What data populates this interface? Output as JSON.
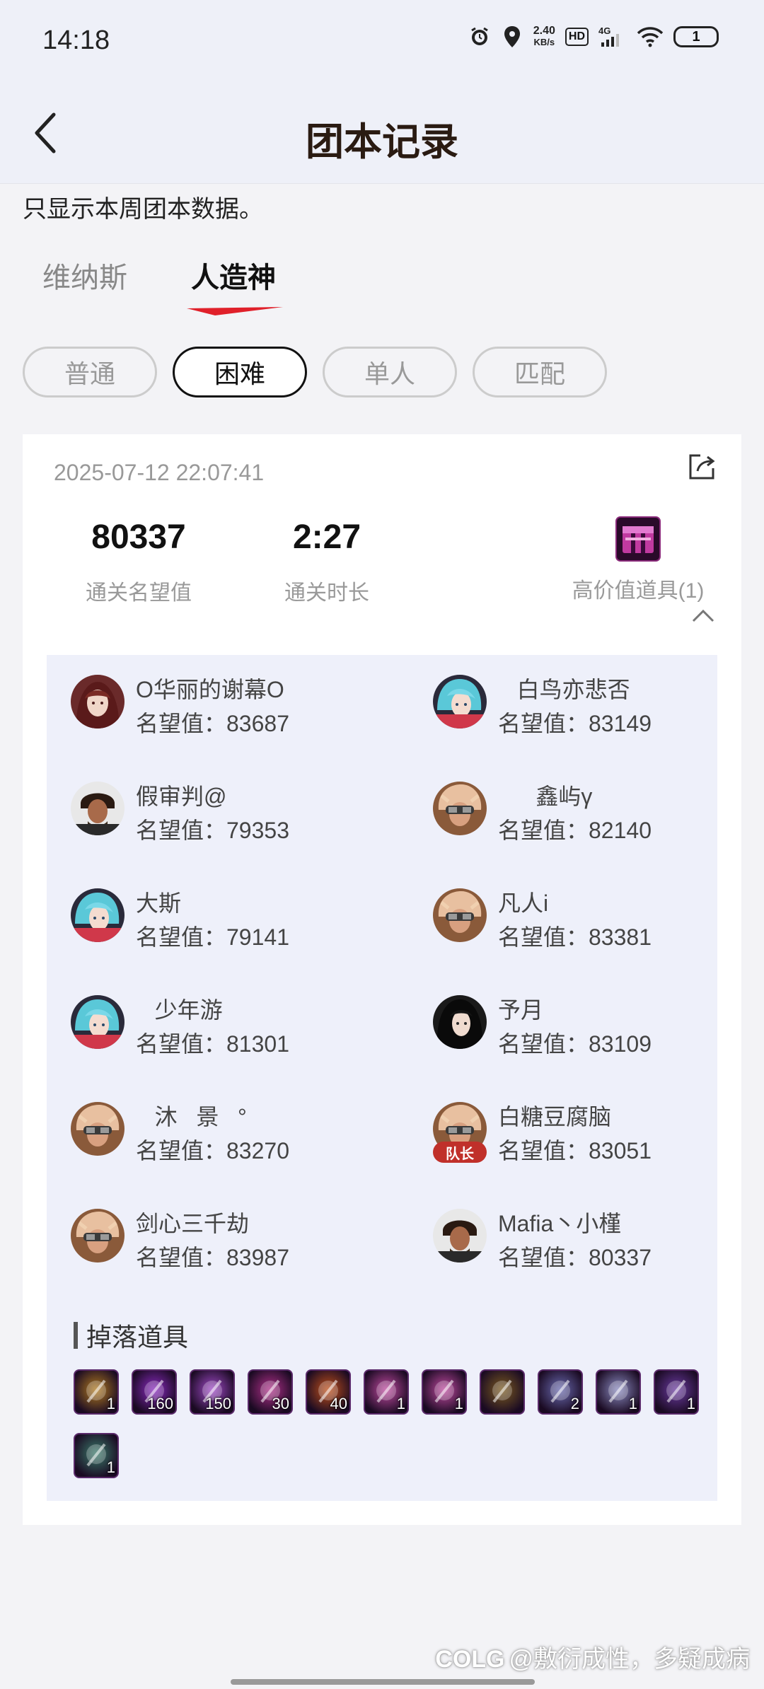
{
  "status_bar": {
    "time": "14:18",
    "net_speed_value": "2.40",
    "net_speed_unit": "KB/s",
    "hd": "HD",
    "network": "4G",
    "battery": "1",
    "icons": [
      "alarm-icon",
      "location-icon",
      "hd-icon",
      "signal-icon",
      "wifi-icon",
      "battery-icon"
    ]
  },
  "nav": {
    "title": "团本记录",
    "back_icon": "chevron-left-icon"
  },
  "notice": "只显示本周团本数据。",
  "boss_tabs": [
    "维纳斯",
    "人造神"
  ],
  "boss_tab_selected": "人造神",
  "difficulty": [
    "普通",
    "困难",
    "单人",
    "匹配"
  ],
  "difficulty_selected": "困难",
  "record": {
    "datetime": "2025-07-12 22:07:41",
    "reputation_value": "80337",
    "reputation_label": "通关名望值",
    "duration_value": "2:27",
    "duration_label": "通关时长",
    "high_value_label": "高价值道具(1)",
    "members": [
      {
        "name": "O华丽的谢幕O",
        "score": "名望值：83687",
        "avatar": "female-mage",
        "leader": false
      },
      {
        "name": "   白鸟亦悲否",
        "score": "名望值：83149",
        "avatar": "female-gunner",
        "leader": false
      },
      {
        "name": "假审判@",
        "score": "名望值：79353",
        "avatar": "male-dark",
        "leader": false
      },
      {
        "name": "      鑫屿γ",
        "score": "名望值：82140",
        "avatar": "male-goggles",
        "leader": false
      },
      {
        "name": "大斯",
        "score": "名望值：79141",
        "avatar": "female-gunner",
        "leader": false
      },
      {
        "name": "凡人i",
        "score": "名望值：83381",
        "avatar": "male-goggles",
        "leader": false
      },
      {
        "name": "   少年游",
        "score": "名望值：81301",
        "avatar": "female-gunner",
        "leader": false
      },
      {
        "name": "予月",
        "score": "名望值：83109",
        "avatar": "female-dark",
        "leader": false
      },
      {
        "name": "   沐   景   °",
        "score": "名望值：83270",
        "avatar": "male-goggles",
        "leader": false
      },
      {
        "name": "白糖豆腐脑",
        "score": "名望值：83051",
        "avatar": "male-goggles",
        "leader": true
      },
      {
        "name": "剑心三千劫",
        "score": "名望值：83987",
        "avatar": "male-goggles",
        "leader": false
      },
      {
        "name": "Mafia丶小槿",
        "score": "名望值：80337",
        "avatar": "male-dark",
        "leader": false
      }
    ],
    "leader_label": "队长",
    "drops_title": "掉落道具",
    "drops": [
      {
        "icon": "gold-weapon-icon",
        "count": "1",
        "color": "#b07a20"
      },
      {
        "icon": "purple-orb-icon",
        "count": "160",
        "color": "#8a2ac0"
      },
      {
        "icon": "purple-crystal-icon",
        "count": "150",
        "color": "#a04ac8"
      },
      {
        "icon": "pink-orb-icon",
        "count": "30",
        "color": "#b0308a"
      },
      {
        "icon": "fire-orb-icon",
        "count": "40",
        "color": "#c0501a"
      },
      {
        "icon": "pink-box-icon",
        "count": "1",
        "color": "#c04aa0"
      },
      {
        "icon": "pink-box-icon",
        "count": "1",
        "color": "#c04aa0"
      },
      {
        "icon": "gold-horn-icon",
        "count": "",
        "color": "#7a5a20"
      },
      {
        "icon": "boot-icon",
        "count": "2",
        "color": "#6a6ab0"
      },
      {
        "icon": "silver-ring-icon",
        "count": "1",
        "color": "#8a8ac0"
      },
      {
        "icon": "claw-icon",
        "count": "1",
        "color": "#6a3aa0"
      },
      {
        "icon": "green-blade-icon",
        "count": "1",
        "color": "#3a7a6a"
      }
    ]
  },
  "watermark": "@敷衍成性，多疑成病"
}
